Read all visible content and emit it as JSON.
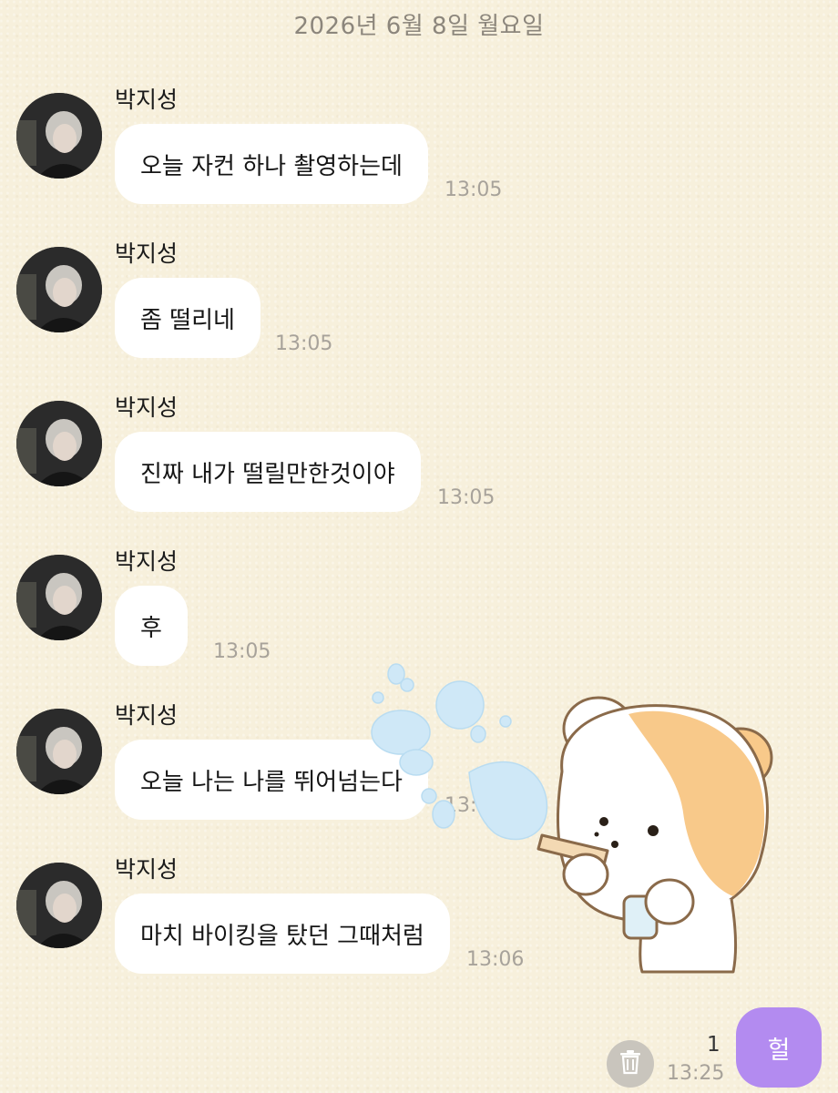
{
  "date_header": "2026년 6월 8일 월요일",
  "messages": [
    {
      "sender": "박지성",
      "text": "오늘 자컨 하나 촬영하는데",
      "time": "13:05"
    },
    {
      "sender": "박지성",
      "text": "좀 떨리네",
      "time": "13:05"
    },
    {
      "sender": "박지성",
      "text": "진짜 내가 떨릴만한것이야",
      "time": "13:05"
    },
    {
      "sender": "박지성",
      "text": "후",
      "time": "13:05"
    },
    {
      "sender": "박지성",
      "text": "오늘 나는 나를 뛰어넘는다",
      "time": "13:06"
    },
    {
      "sender": "박지성",
      "text": "마치 바이킹을 탔던 그때처럼",
      "time": "13:06"
    }
  ],
  "my_message": {
    "text": "헐",
    "time": "13:25",
    "unread_count": "1"
  },
  "icons": {
    "delete": "trash-icon",
    "sticker": "hamster-bubble-sticker"
  },
  "colors": {
    "my_bubble": "#b38bf0",
    "their_bubble": "#ffffff",
    "background": "#f7f0dc"
  }
}
